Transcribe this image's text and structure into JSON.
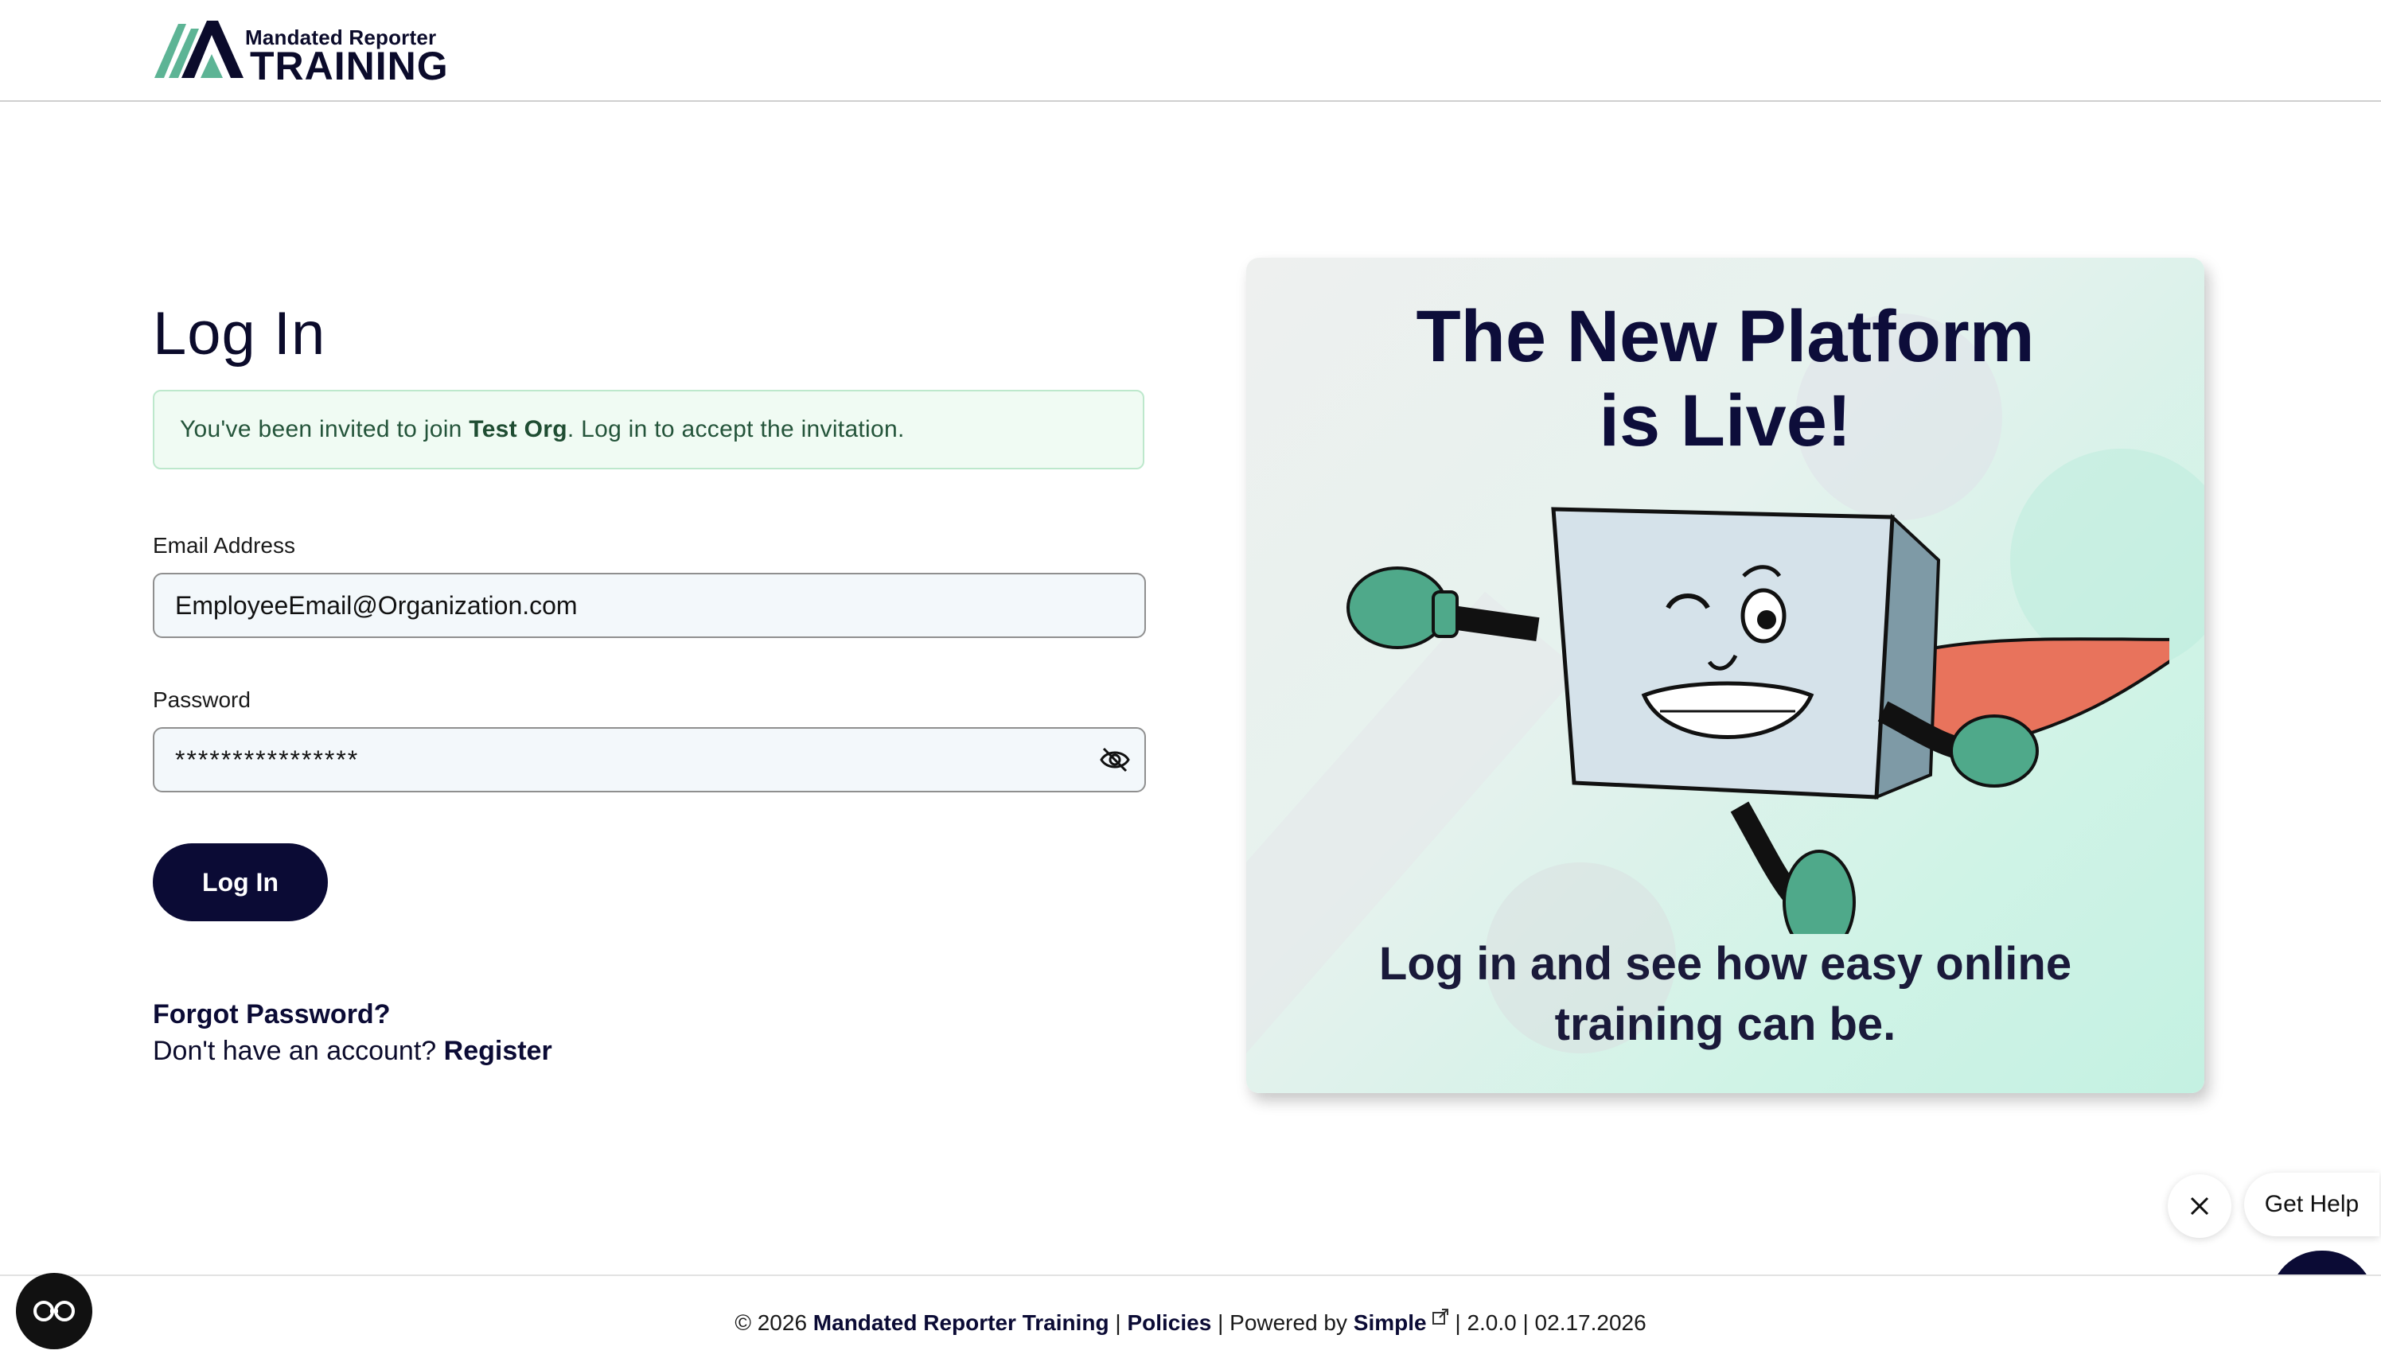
{
  "brand": {
    "logo_sub": "Mandated Reporter",
    "logo_main": "TRAINING",
    "colors": {
      "navy": "#0b0b35",
      "green": "#5db495",
      "alert_bg": "#f0fbf3"
    }
  },
  "login": {
    "title": "Log In",
    "alert": {
      "prefix": "You've been invited to join ",
      "org": "Test Org",
      "suffix": ". Log in to accept the invitation."
    },
    "email_label": "Email Address",
    "email_value": "EmployeeEmail@Organization.com",
    "password_label": "Password",
    "password_value": "****************",
    "password_toggle_icon": "eye-slash-icon",
    "submit_label": "Log In",
    "forgot_label": "Forgot Password?",
    "register_prompt": "Don't have an account? ",
    "register_label": "Register"
  },
  "promo": {
    "headline_line1": "The New Platform",
    "headline_line2": "is Live!",
    "sub_line1": "Log in and see how easy online",
    "sub_line2": "training can be."
  },
  "chat": {
    "help_label": "Get Help",
    "close_icon": "close-icon",
    "launcher_icon": "chat-bubble-icon"
  },
  "footer": {
    "copyright": "© 2026 ",
    "org_name": "Mandated Reporter Training",
    "sep1": " | ",
    "policies": "Policies",
    "powered_by": " | Powered by ",
    "vendor": "Simple",
    "version_info": " | 2.0.0 | 02.17.2026",
    "accessibility_icon": "accessibility-icon"
  }
}
